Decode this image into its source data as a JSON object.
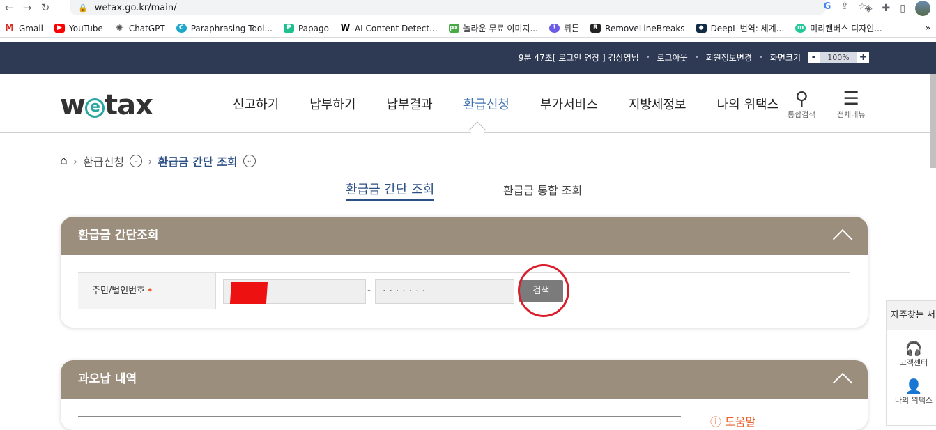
{
  "browser": {
    "url": "wetax.go.kr/main/",
    "bookmarks": [
      "Gmail",
      "YouTube",
      "ChatGPT",
      "Paraphrasing Tool...",
      "Papago",
      "AI Content Detect...",
      "놀라운 무료 이미지...",
      "뤼튼",
      "RemoveLineBreaks",
      "DeepL 번역: 세계...",
      "미리캔버스 디자인..."
    ]
  },
  "topbar": {
    "session": "9분 47초[ 로그인 연장 ] 김상영님",
    "logout": "로그아웃",
    "member_edit": "회원정보변경",
    "screen_size": "화면크기",
    "zoom_minus": "-",
    "zoom_value": "100%",
    "zoom_plus": "+"
  },
  "gnb": {
    "logo": "wetax",
    "menu": [
      "신고하기",
      "납부하기",
      "납부결과",
      "환급신청",
      "부가서비스",
      "지방세정보",
      "나의 위택스"
    ],
    "search_label": "통합검색",
    "all_menu_label": "전체메뉴"
  },
  "breadcrumb": {
    "level1": "환급신청",
    "level2": "환급금 간단 조회"
  },
  "tabs": {
    "active": "환급금 간단 조회",
    "other": "환급금 통합 조회"
  },
  "panel1": {
    "title": "환급금 간단조회",
    "field_label": "주민/법인번호",
    "required_mark": "•",
    "dash": "-",
    "second_value": "·······",
    "search_button": "검색"
  },
  "panel2": {
    "title": "과오납 내역"
  },
  "help": "도움말",
  "side": {
    "title": "자주찾는 서비스",
    "items": [
      "고객센터",
      "나의 위택스"
    ]
  }
}
